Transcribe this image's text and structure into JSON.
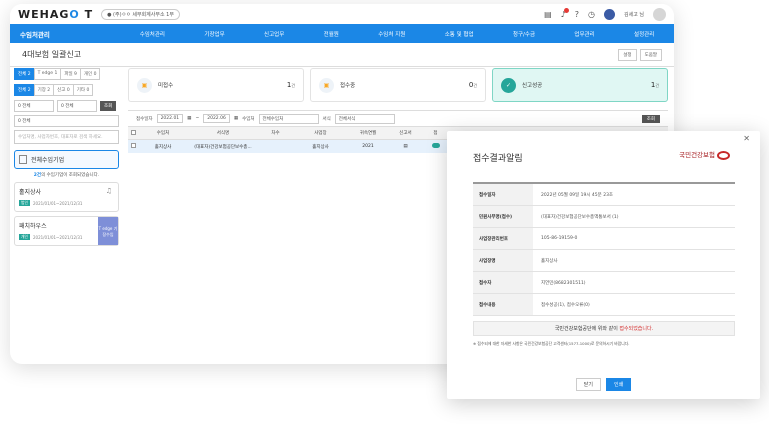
{
  "app": {
    "logo_text": "WEHAG",
    "logo_o": "O",
    "logo_t": " T",
    "company": "● (주)ㅇㅇ 세무회계사무소 1부",
    "username": "김세고 님"
  },
  "topbar_icons": [
    "document-icon",
    "bell-icon",
    "help-icon",
    "clock-icon"
  ],
  "nav": {
    "brand": "수임처관리",
    "items": [
      "수임처관리",
      "기장업무",
      "신고업무",
      "전월원",
      "수임처 지원",
      "소통 및 협업",
      "청구/수금",
      "업무관리",
      "설정관리"
    ]
  },
  "page": {
    "title": "4대보험 일괄신고",
    "btn1": "설정",
    "btn2": "도움말"
  },
  "sidebar": {
    "tabs1": [
      "전체 2",
      "T edge 1",
      "파일 9",
      "개인 0"
    ],
    "tabs2": [
      "전체 2",
      "기장 2",
      "신고 0",
      "기타 0"
    ],
    "select1": "0 전체",
    "select2": "0 전체",
    "query_btn": "조회",
    "select3": "0 전체",
    "search_placeholder": "수임처명, 사업자번호, 대표자로 검색 하세요.",
    "all_clients": "전체수임기업",
    "count_prefix": "",
    "count_num": "2건",
    "count_suffix": "의 수임기업이 조회되었습니다.",
    "cards": [
      {
        "name": "홀지상사",
        "tag": "법인",
        "date": "2021/01/01~2021/12/31"
      },
      {
        "name": "패치하우스",
        "tag": "개인",
        "date": "2021/01/01~2021/12/31",
        "side": "T edge 기장수임"
      }
    ]
  },
  "stats": [
    {
      "label": "미접수",
      "count": "1",
      "unit": "건"
    },
    {
      "label": "접수중",
      "count": "0",
      "unit": "건"
    },
    {
      "label": "신고성공",
      "count": "1",
      "unit": "건"
    }
  ],
  "filter": {
    "label_date": "접수일자",
    "date_from": "2022.01",
    "tilde": "~",
    "date_to": "2022.06",
    "label_client": "수임처",
    "client": "전체수임처",
    "label_form": "서식",
    "form": "전체서식",
    "go": "조회"
  },
  "table": {
    "headers": [
      "수임처",
      "서식명",
      "차수",
      "사업장",
      "귀속연월",
      "신고서",
      "접"
    ],
    "row": [
      "홀지상사",
      "(대표자)건강보험공단보수총...",
      "",
      "홀지상사",
      "2021",
      "▤",
      ""
    ]
  },
  "popup": {
    "title": "접수결과알림",
    "org": "국민건강보험",
    "rows": [
      {
        "k": "접수일자",
        "v": "2022년 05월 09일 19시 45분 23초"
      },
      {
        "k": "민원사무명(접수)",
        "v": "(대표자)건강보험공단보수총액통보서 (1)"
      },
      {
        "k": "사업장관리번호",
        "v": "105-86-19159-0"
      },
      {
        "k": "사업장명",
        "v": "홀지상사"
      },
      {
        "k": "접수자",
        "v": "지언민(8682301511)"
      },
      {
        "k": "접수내용",
        "v": "접수성공(1), 접수오류(0)"
      }
    ],
    "notice_main": "국민건강보험공단에 위와 같이 ",
    "notice_hl": "접수되었습니다.",
    "note": "※ 접수되에 대한 자세한 사항은 국민건강보험공단 고객센터(1577-1000)로 문의하시기 바랍니다.",
    "close_btn": "닫기",
    "print_btn": "인쇄"
  }
}
